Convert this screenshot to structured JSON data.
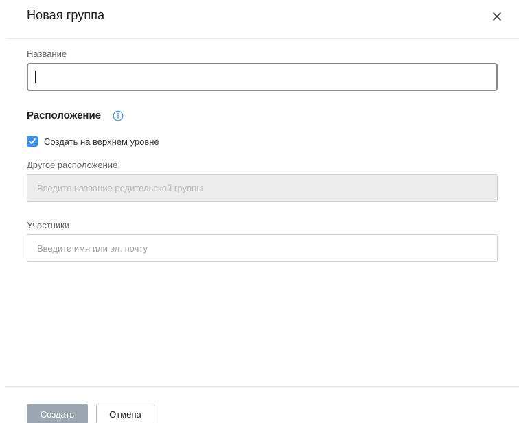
{
  "dialog": {
    "title": "Новая группа",
    "close_icon": "close-icon"
  },
  "name_field": {
    "label": "Название",
    "value": "",
    "placeholder": ""
  },
  "location": {
    "section_title": "Расположение",
    "info_icon": "info-icon",
    "top_level_checkbox": {
      "label": "Создать на верхнем уровне",
      "checked": true
    },
    "other_location_label": "Другое расположение",
    "parent_placeholder": "Введите название родительской группы",
    "parent_disabled": true
  },
  "members": {
    "label": "Участники",
    "placeholder": "Введите имя или эл. почту"
  },
  "footer": {
    "create_label": "Создать",
    "cancel_label": "Отмена"
  },
  "colors": {
    "accent": "#3d8fe0",
    "create_button_disabled": "#9ba6b0",
    "disabled_field_bg": "#ececec"
  }
}
